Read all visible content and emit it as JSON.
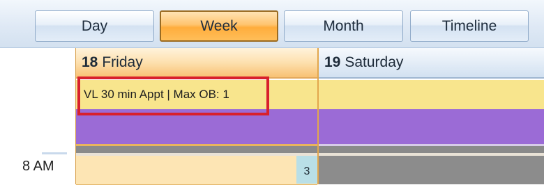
{
  "toolbar": {
    "views": [
      {
        "label": "Day",
        "active": false
      },
      {
        "label": "Week",
        "active": true
      },
      {
        "label": "Month",
        "active": false
      },
      {
        "label": "Timeline",
        "active": false
      }
    ]
  },
  "days": [
    {
      "number": "18",
      "name": "Friday"
    },
    {
      "number": "19",
      "name": "Saturday"
    }
  ],
  "appointment": {
    "text": "VL 30 min Appt | Max OB: 1"
  },
  "time_slot": {
    "label": "8 AM",
    "count": "3"
  },
  "colors": {
    "active_button": "#ffbe59",
    "highlight_border": "#d8202c",
    "available_band": "#f8e58d",
    "blocked_band": "#9b6bd6",
    "count_badge": "#b9dfe7"
  }
}
